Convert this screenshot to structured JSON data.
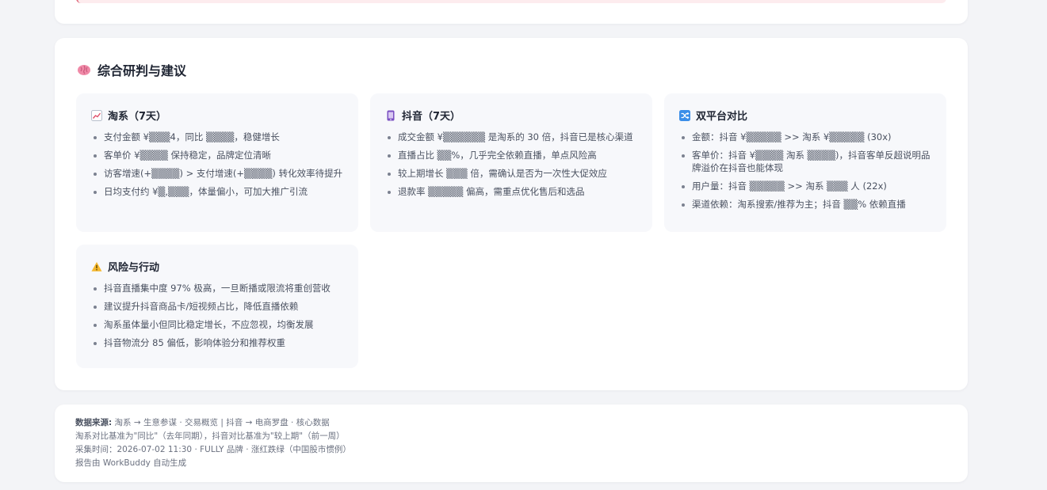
{
  "section": {
    "title": "综合研判与建议"
  },
  "panels": [
    {
      "title": "淘系（7天）",
      "items": [
        "支付金额 ¥▒▒▒4，同比 ▒▒▒▒，稳健增长",
        "客单价 ¥▒▒▒▒ 保持稳定，品牌定位清晰",
        "访客增速(+▒▒▒▒) > 支付增速(+▒▒▒▒) 转化效率待提升",
        "日均支付约 ¥▒,▒▒▒，体量偏小，可加大推广引流"
      ]
    },
    {
      "title": "抖音（7天）",
      "items": [
        "成交金额 ¥▒▒▒▒▒▒ 是淘系的 30 倍，抖音已是核心渠道",
        "直播占比 ▒▒%，几乎完全依赖直播，单点风险高",
        "较上期增长 ▒▒▒ 倍，需确认是否为一次性大促效应",
        "退款率 ▒▒▒▒▒ 偏高，需重点优化售后和选品"
      ]
    },
    {
      "title": "双平台对比",
      "items": [
        "金额：抖音 ¥▒▒▒▒▒ >> 淘系 ¥▒▒▒▒▒ (30x)",
        "客单价：抖音 ¥▒▒▒▒ 淘系 ▒▒▒▒)，抖音客单反超说明品牌溢价在抖音也能体现",
        "用户量：抖音 ▒▒▒▒▒ >> 淘系 ▒▒▒ 人 (22x)",
        "渠道依赖：淘系搜索/推荐为主；抖音 ▒▒% 依赖直播"
      ]
    },
    {
      "title": "风险与行动",
      "items": [
        "抖音直播集中度 97% 极高，一旦断播或限流将重创营收",
        "建议提升抖音商品卡/短视频占比，降低直播依赖",
        "淘系虽体量小但同比稳定增长，不应忽视，均衡发展",
        "抖音物流分 85 偏低，影响体验分和推荐权重"
      ]
    }
  ],
  "footer": {
    "source_label": "数据来源:",
    "source_text": "淘系 → 生意参谋 · 交易概览 | 抖音 → 电商罗盘 · 核心数据",
    "baseline": "淘系对比基准为\"同比\"（去年同期），抖音对比基准为\"较上期\"（前一周）",
    "collected": "采集时间：2026-07-02 11:30 · FULLY 品牌 · 涨红跌绿（中国股市惯例）",
    "generated": "报告由 WorkBuddy 自动生成"
  }
}
